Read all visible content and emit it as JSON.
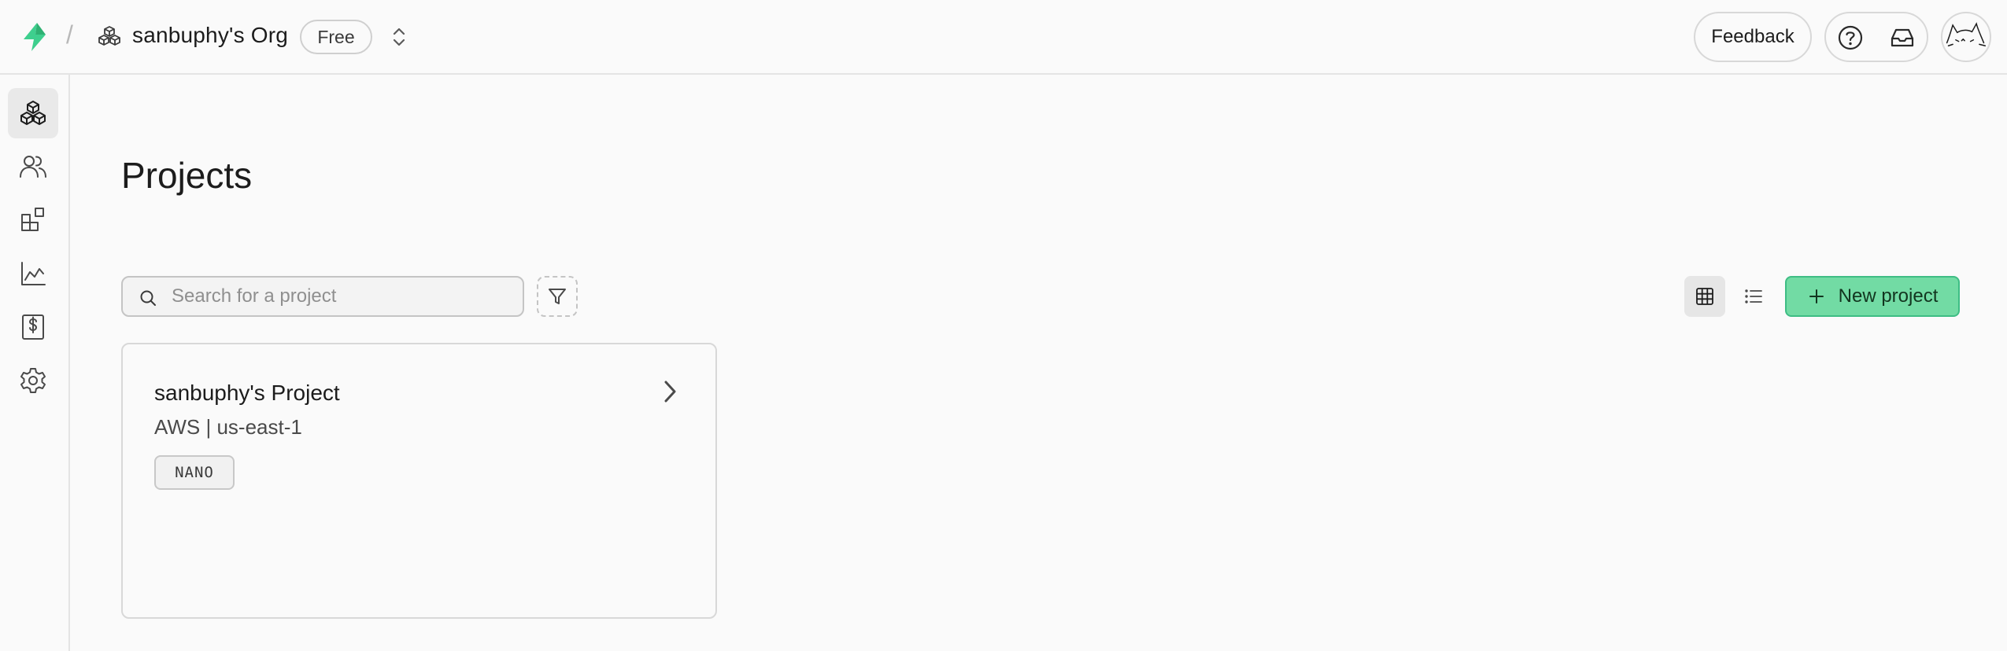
{
  "header": {
    "separator": "/",
    "org_name": "sanbuphy's Org",
    "plan_badge": "Free",
    "feedback_label": "Feedback"
  },
  "icons": {
    "logo": "supabase-logo-icon",
    "org": "org-cubes-icon",
    "switch": "chevron-up-down-icon",
    "help": "help-circle-icon",
    "inbox": "inbox-icon",
    "avatar": "cat-avatar-icon"
  },
  "sidebar": {
    "items": [
      {
        "icon": "projects-cubes-icon",
        "active": true
      },
      {
        "icon": "team-users-icon",
        "active": false
      },
      {
        "icon": "integrations-blocks-icon",
        "active": false
      },
      {
        "icon": "usage-chart-icon",
        "active": false
      },
      {
        "icon": "billing-dollar-icon",
        "active": false
      },
      {
        "icon": "settings-gear-icon",
        "active": false
      }
    ]
  },
  "main": {
    "title": "Projects",
    "search": {
      "placeholder": "Search for a project",
      "value": ""
    },
    "new_project_label": "New project",
    "projects": [
      {
        "name": "sanbuphy's Project",
        "region": "AWS | us-east-1",
        "tier": "NANO"
      }
    ]
  },
  "colors": {
    "brand_green": "#3ecf8e",
    "button_green": "#72dba4",
    "button_border": "#3ebd84"
  }
}
